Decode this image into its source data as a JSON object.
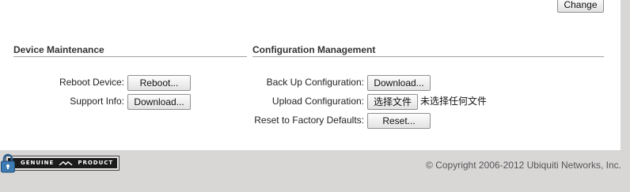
{
  "header": {
    "change_button": "Change"
  },
  "device_maintenance": {
    "title": "Device Maintenance",
    "reboot": {
      "label": "Reboot Device:",
      "button": "Reboot..."
    },
    "support": {
      "label": "Support Info:",
      "button": "Download..."
    }
  },
  "configuration_management": {
    "title": "Configuration Management",
    "backup": {
      "label": "Back Up Configuration:",
      "button": "Download..."
    },
    "upload": {
      "label": "Upload Configuration:",
      "button": "选择文件",
      "status": "未选择任何文件"
    },
    "reset": {
      "label": "Reset to Factory Defaults:",
      "button": "Reset..."
    }
  },
  "footer": {
    "badge_left": "GENUINE",
    "badge_right": "PRODUCT",
    "copyright": "© Copyright 2006-2012 Ubiquiti Networks, Inc."
  },
  "colors": {
    "page_bg": "#d9d6d6",
    "panel_bg": "#ffffff"
  },
  "icons": [
    "lock-icon",
    "ubiquiti-logo-icon"
  ]
}
